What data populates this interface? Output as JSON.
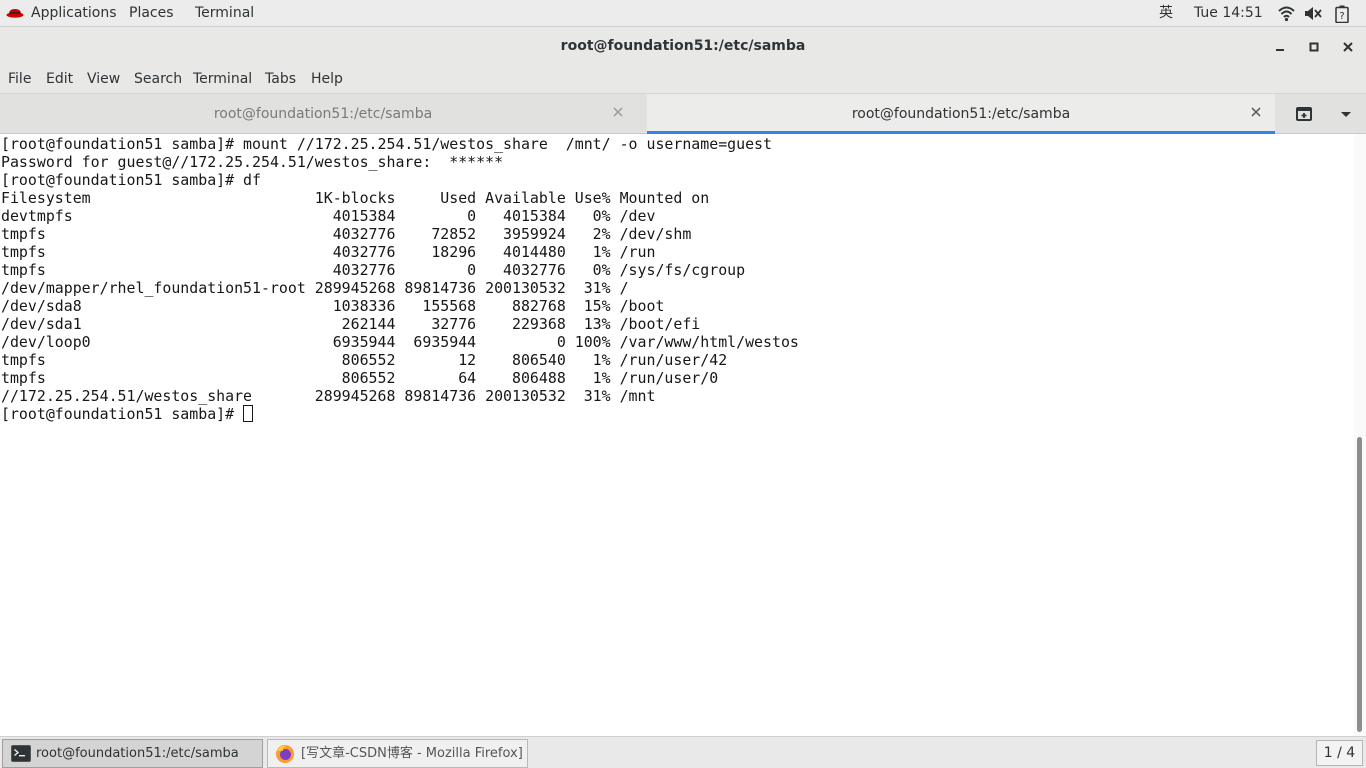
{
  "topbar": {
    "applications": "Applications",
    "places": "Places",
    "terminal": "Terminal",
    "input_method": "英",
    "clock": "Tue 14:51"
  },
  "window": {
    "title": "root@foundation51:/etc/samba"
  },
  "menubar": {
    "items": [
      "File",
      "Edit",
      "View",
      "Search",
      "Terminal",
      "Tabs",
      "Help"
    ]
  },
  "tabs": [
    {
      "label": "root@foundation51:/etc/samba",
      "active": false
    },
    {
      "label": "root@foundation51:/etc/samba",
      "active": true
    }
  ],
  "terminal": {
    "lines": [
      "[root@foundation51 samba]# mount //172.25.254.51/westos_share  /mnt/ -o username=guest",
      "Password for guest@//172.25.254.51/westos_share:  ******",
      "[root@foundation51 samba]# df",
      "Filesystem                         1K-blocks     Used Available Use% Mounted on",
      "devtmpfs                             4015384        0   4015384   0% /dev",
      "tmpfs                                4032776    72852   3959924   2% /dev/shm",
      "tmpfs                                4032776    18296   4014480   1% /run",
      "tmpfs                                4032776        0   4032776   0% /sys/fs/cgroup",
      "/dev/mapper/rhel_foundation51-root 289945268 89814736 200130532  31% /",
      "/dev/sda8                            1038336   155568    882768  15% /boot",
      "/dev/sda1                             262144    32776    229368  13% /boot/efi",
      "/dev/loop0                           6935944  6935944         0 100% /var/www/html/westos",
      "tmpfs                                 806552       12    806540   1% /run/user/42",
      "tmpfs                                 806552       64    806488   1% /run/user/0",
      "//172.25.254.51/westos_share       289945268 89814736 200130532  31% /mnt"
    ],
    "prompt": "[root@foundation51 samba]# "
  },
  "taskbar": {
    "items": [
      {
        "label": "root@foundation51:/etc/samba"
      },
      {
        "label": "[写文章-CSDN博客 - Mozilla Firefox]"
      }
    ],
    "workspace": "1 / 4"
  },
  "colors": {
    "accent": "#3584e4",
    "redhat": "#cc0000"
  }
}
